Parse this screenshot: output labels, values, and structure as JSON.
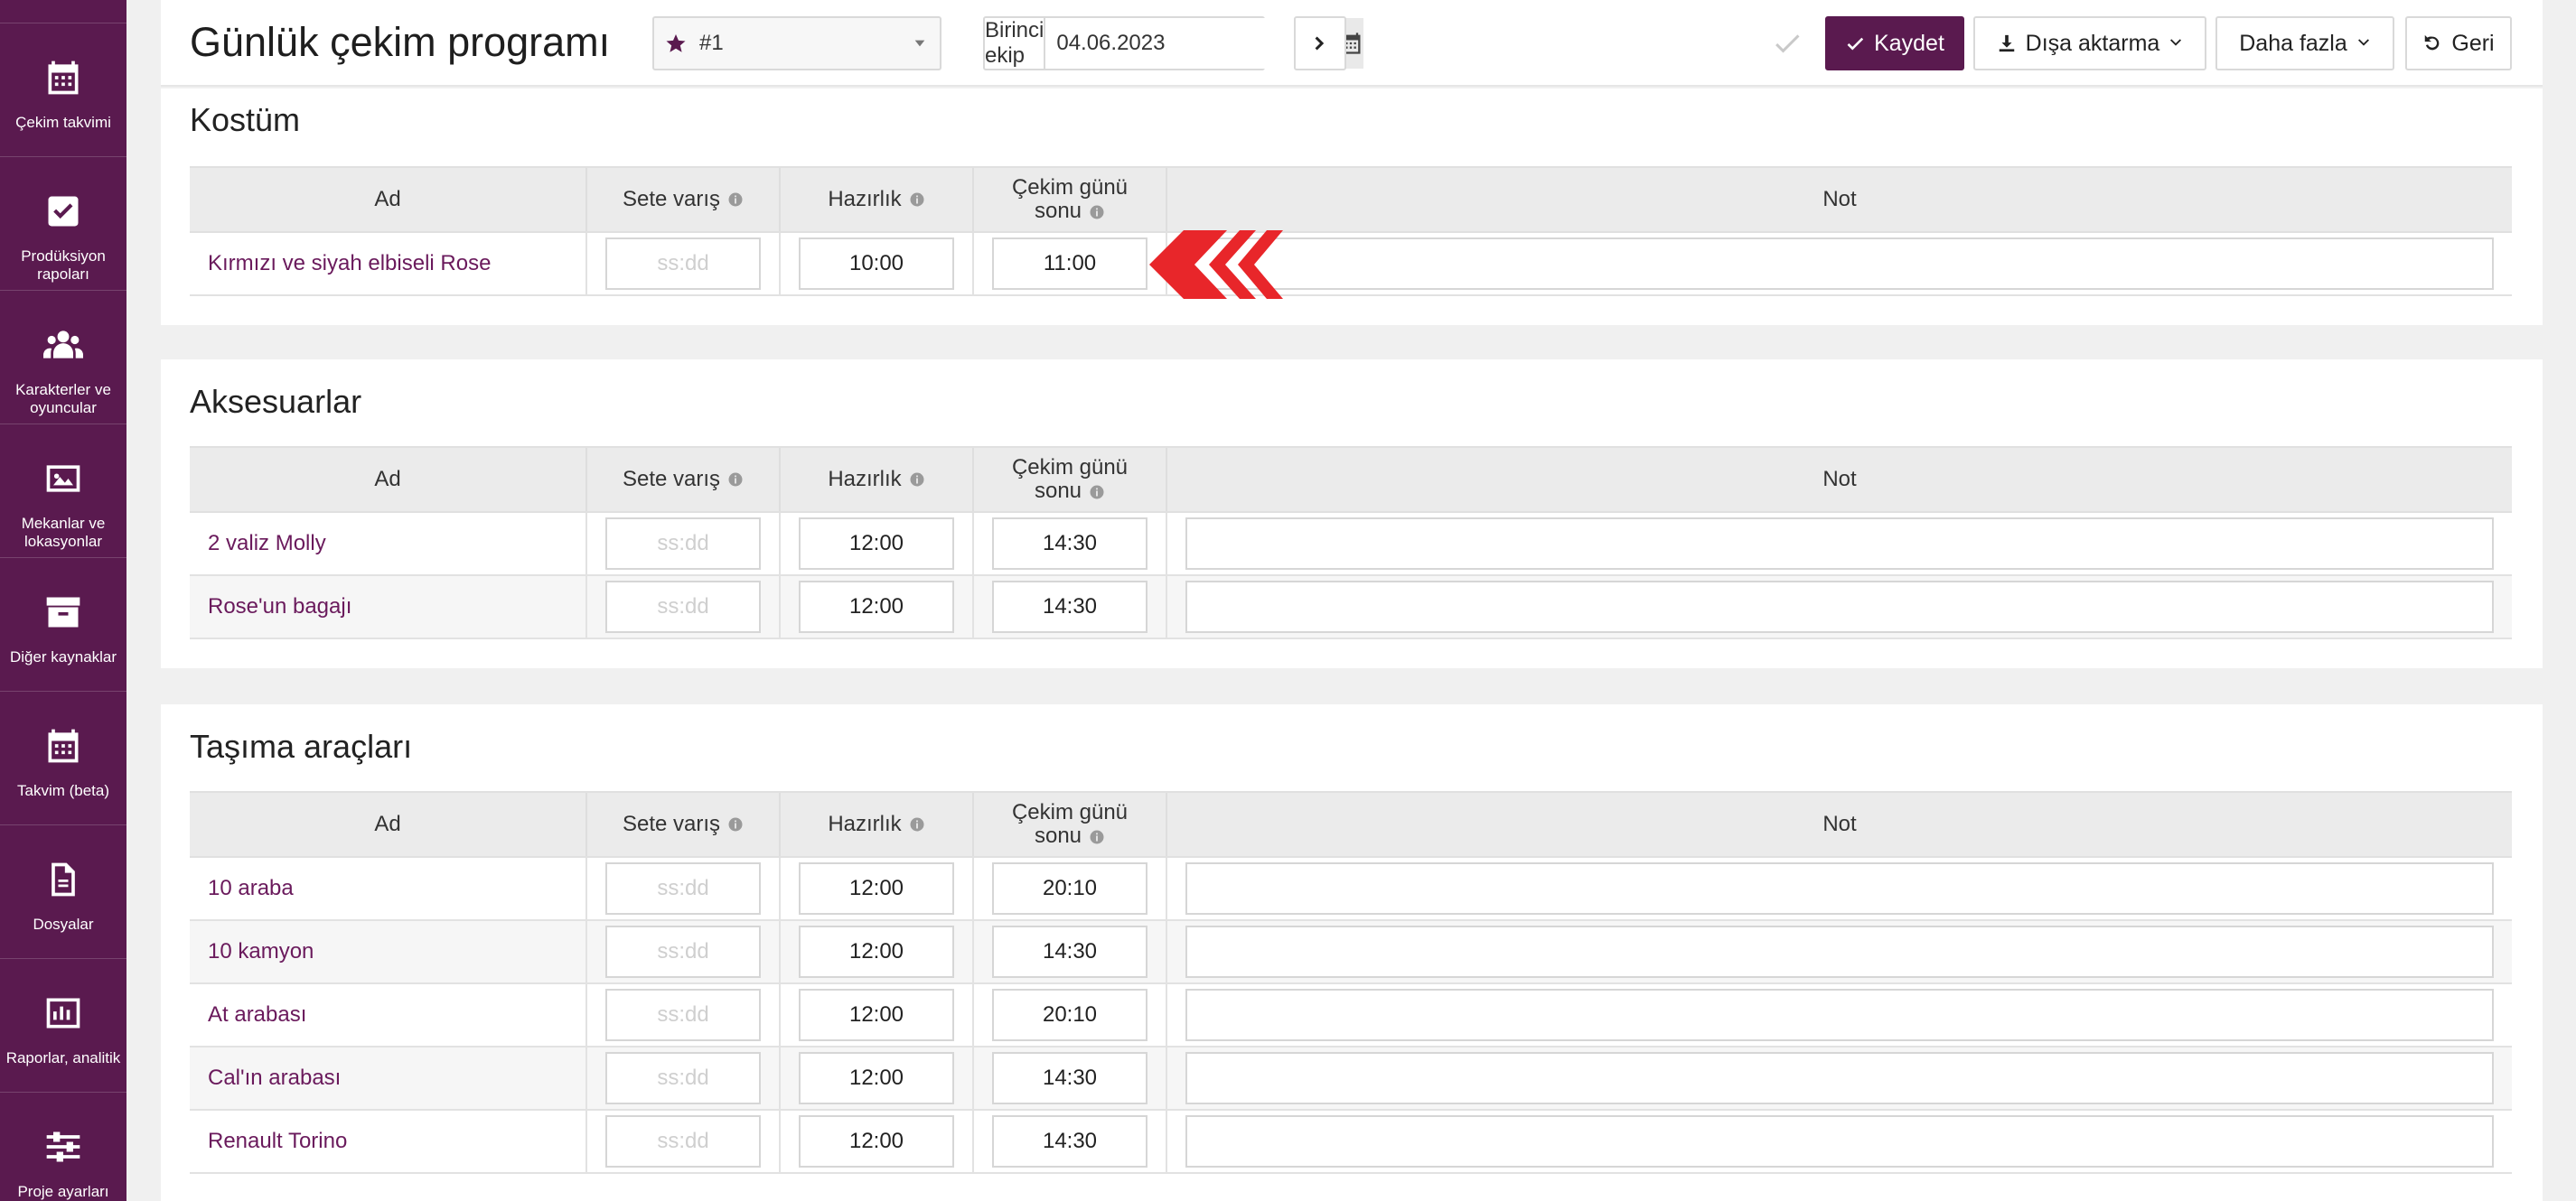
{
  "sidebar": {
    "items": [
      {
        "label": "Çekim takvimi",
        "icon": "calendar-icon"
      },
      {
        "label": "Prodüksiyon rapoları",
        "icon": "check-square-icon"
      },
      {
        "label": "Karakterler ve oyuncular",
        "icon": "users-icon"
      },
      {
        "label": "Mekanlar ve lokasyonlar",
        "icon": "image-icon"
      },
      {
        "label": "Diğer kaynaklar",
        "icon": "archive-icon"
      },
      {
        "label": "Takvim (beta)",
        "icon": "calendar-icon"
      },
      {
        "label": "Dosyalar",
        "icon": "file-icon"
      },
      {
        "label": "Raporlar, analitik",
        "icon": "bar-chart-icon"
      },
      {
        "label": "Proje ayarları",
        "icon": "sliders-icon"
      }
    ]
  },
  "header": {
    "title": "Günlük çekim programı",
    "day_select": "#1",
    "crew_label": "Birinci ekip",
    "date": "04.06.2023",
    "save_label": "Kaydet",
    "export_label": "Dışa aktarma",
    "more_label": "Daha fazla",
    "back_label": "Geri"
  },
  "columns": {
    "name": "Ad",
    "arrival": "Sete varış",
    "prep": "Hazırlık",
    "end_line1": "Çekim günü",
    "end_line2": "sonu",
    "note": "Not"
  },
  "time_placeholder": "ss:dd",
  "sections": {
    "kostum": {
      "title": "Kostüm",
      "rows": [
        {
          "name": "Kırmızı ve siyah elbiseli Rose",
          "arrival": "",
          "prep": "10:00",
          "end": "11:00"
        }
      ]
    },
    "aksesuarlar": {
      "title": "Aksesuarlar",
      "rows": [
        {
          "name": "2 valiz Molly",
          "arrival": "",
          "prep": "12:00",
          "end": "14:30"
        },
        {
          "name": "Rose'un bagajı",
          "arrival": "",
          "prep": "12:00",
          "end": "14:30"
        }
      ]
    },
    "tasima": {
      "title": "Taşıma araçları",
      "rows": [
        {
          "name": "10 araba",
          "arrival": "",
          "prep": "12:00",
          "end": "20:10"
        },
        {
          "name": "10 kamyon",
          "arrival": "",
          "prep": "12:00",
          "end": "14:30"
        },
        {
          "name": "At arabası",
          "arrival": "",
          "prep": "12:00",
          "end": "20:10"
        },
        {
          "name": "Cal'ın arabası",
          "arrival": "",
          "prep": "12:00",
          "end": "14:30"
        },
        {
          "name": "Renault Torino",
          "arrival": "",
          "prep": "12:00",
          "end": "14:30"
        }
      ]
    }
  },
  "colors": {
    "brand": "#5a1a4f",
    "link": "#6a1a5c",
    "highlight_arrow": "#e8262a"
  }
}
